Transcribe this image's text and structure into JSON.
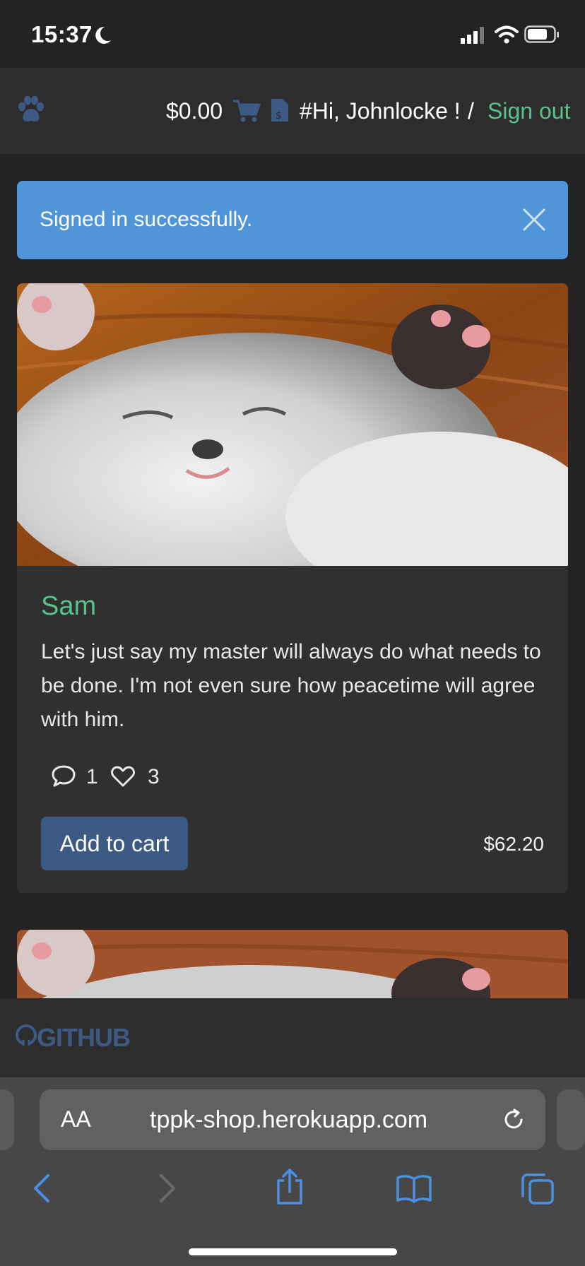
{
  "status": {
    "time": "15:37"
  },
  "nav": {
    "balance": "$0.00",
    "greeting": "#Hi, Johnlocke !",
    "separator": "/",
    "signout": "Sign out"
  },
  "alert": {
    "message": "Signed in successfully."
  },
  "product": {
    "name": "Sam",
    "description": "Let's just say my master will always do what needs to be done. I'm not even sure how peacetime will agree with him.",
    "comments": "1",
    "likes": "3",
    "add_label": "Add to cart",
    "price": "$62.20"
  },
  "footer": {
    "github": "GITHUB"
  },
  "browser": {
    "aa": "AA",
    "url": "tppk-shop.herokuapp.com"
  },
  "colors": {
    "accent": "#58c18e",
    "alert": "#4f95d8",
    "button": "#3d5a85"
  }
}
